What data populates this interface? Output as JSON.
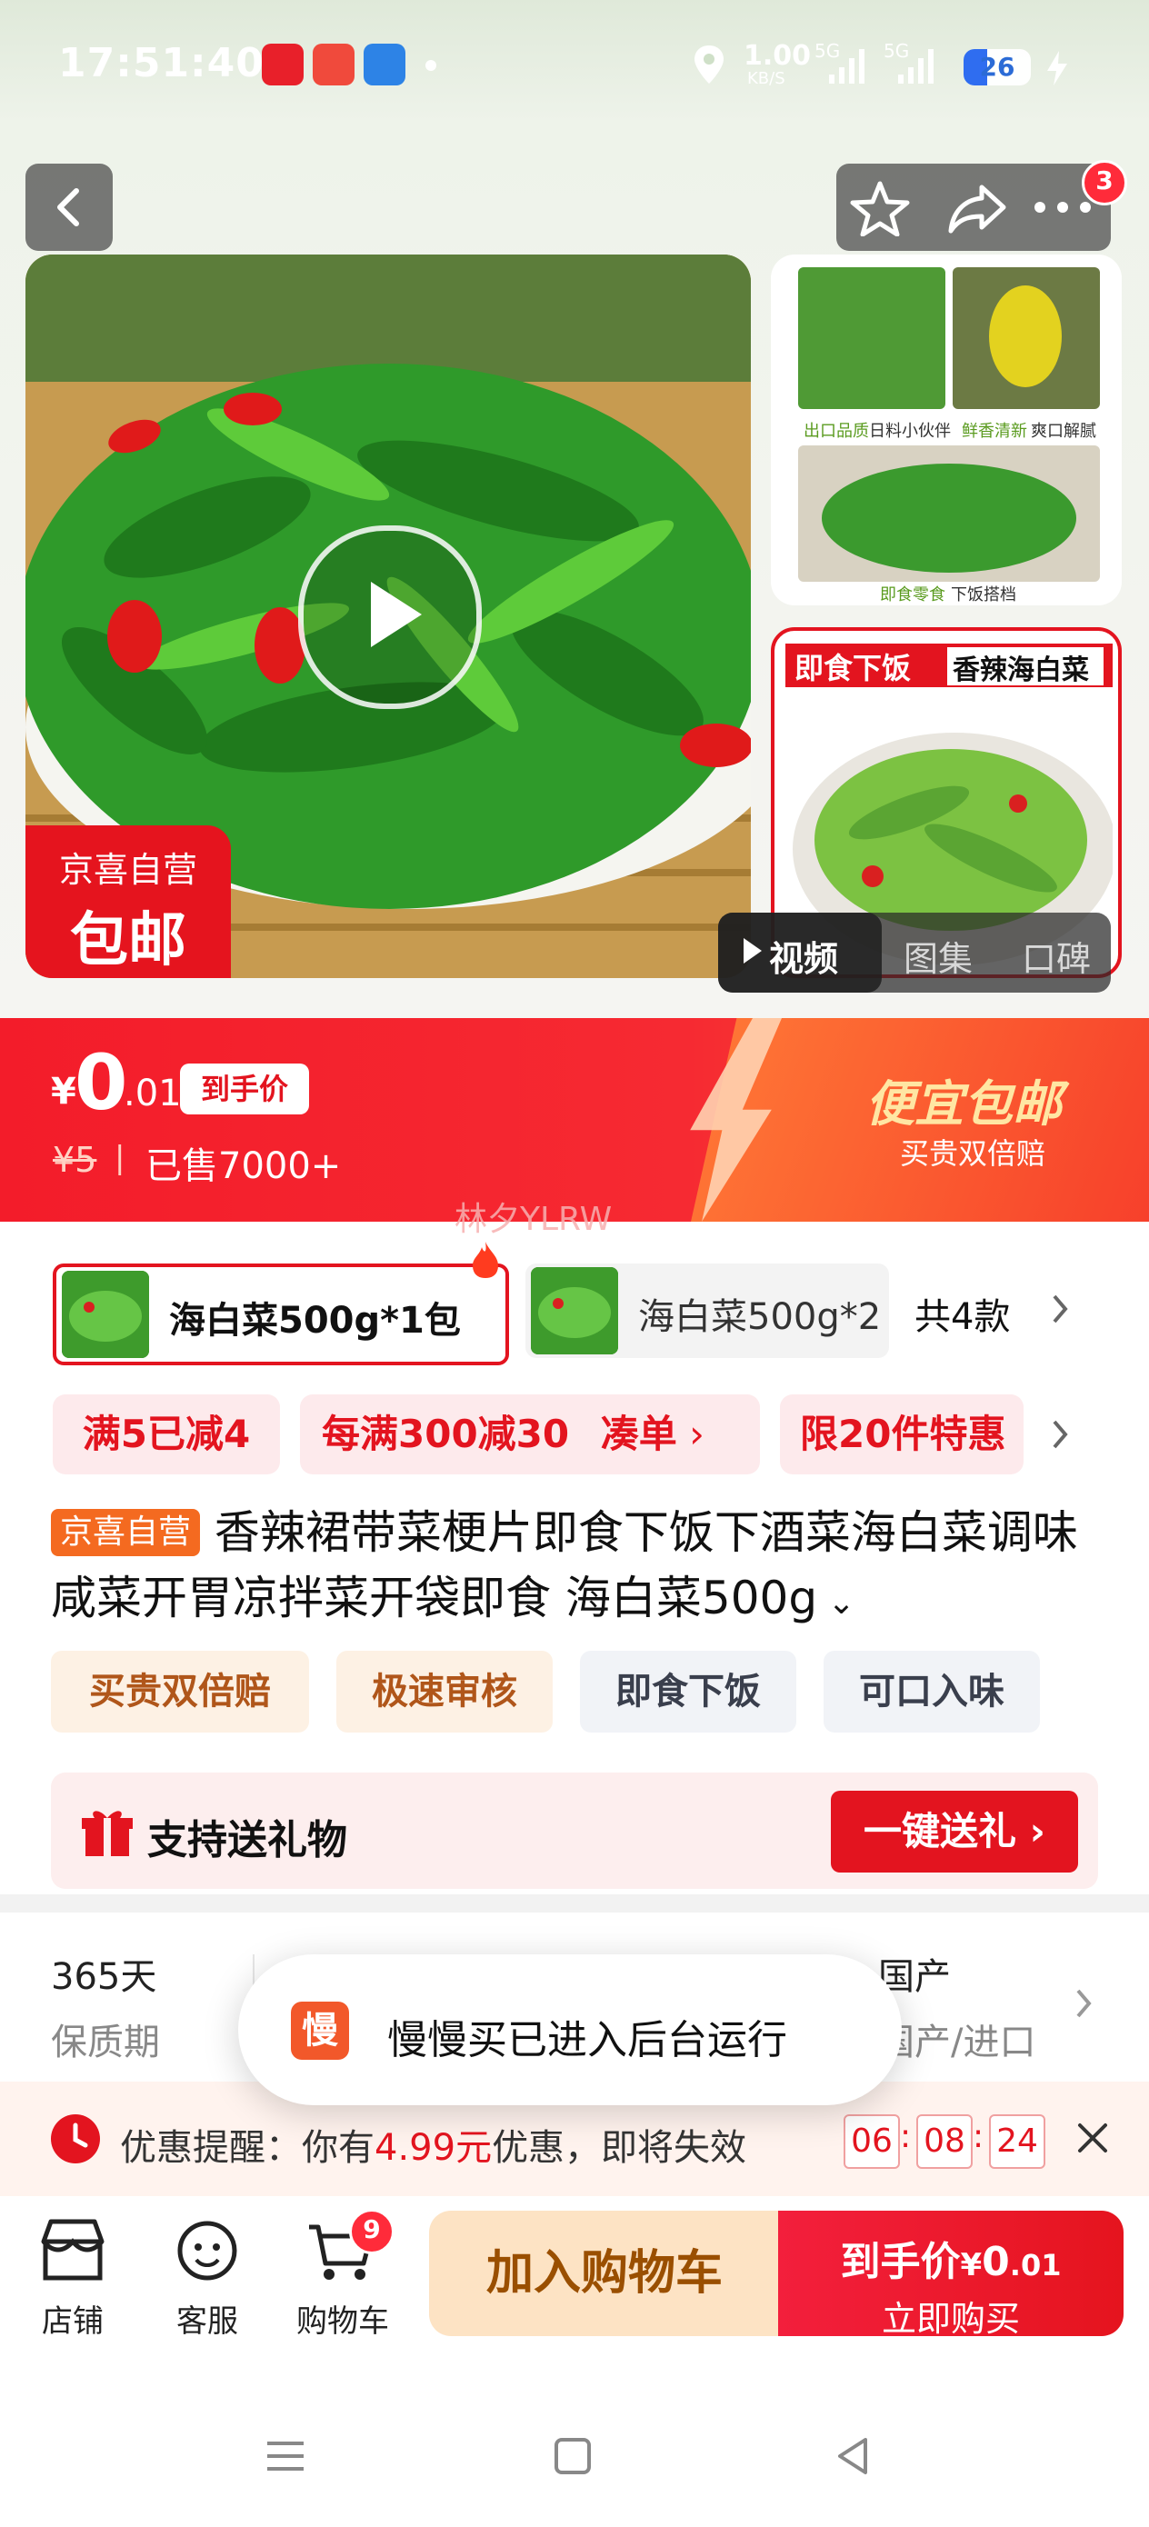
{
  "status_bar": {
    "time": "17:51:40",
    "net_speed": "1.00",
    "net_unit": "KB/S",
    "signal1": "5G",
    "signal2": "5G",
    "battery": "26"
  },
  "header": {
    "notification_count": "3"
  },
  "gallery": {
    "thumb1_captions": [
      "出口品质",
      "日料小伙伴",
      "鲜香清新",
      "爽口解腻",
      "即食零食",
      "下饭搭档"
    ],
    "thumb2_banner_left": "即食下饭",
    "thumb2_banner_right": "香辣海白菜",
    "badge_line1": "京喜自营",
    "badge_line2": "包邮",
    "tabs": [
      "视频",
      "图集",
      "口碑"
    ]
  },
  "price": {
    "currency": "¥",
    "integer": "0",
    "decimal": ".01",
    "tag": "到手价",
    "original": "¥5",
    "separator": "|",
    "sold": "已售7000+",
    "promo_title": "便宜包邮",
    "promo_sub": "买贵双倍赔",
    "watermark": "林夕YLRW"
  },
  "sku": {
    "selected": "海白菜500g*1包",
    "other": "海白菜500g*2",
    "total": "共4款"
  },
  "promos": [
    "满5已减4",
    "每满300减30",
    "凑单",
    "限20件特惠"
  ],
  "product": {
    "store_tag": "京喜自营",
    "title": "香辣裙带菜梗片即食下饭下酒菜海白菜调味咸菜开胃凉拌菜开袋即食 海白菜500g"
  },
  "chips": [
    "买贵双倍赔",
    "极速审核",
    "即食下饭",
    "可口入味"
  ],
  "gift": {
    "label": "支持送礼物",
    "button": "一键送礼"
  },
  "specs": {
    "shelf_value": "365天",
    "shelf_label": "保质期",
    "origin_value": "国产",
    "origin_label": "国产/进口"
  },
  "toast": {
    "icon_char": "慢",
    "text": "慢慢买已进入后台运行"
  },
  "reminder": {
    "prefix": "优惠提醒：你有",
    "amount": "4.99元",
    "suffix": "优惠，即将失效",
    "hh": "06",
    "mm": "08",
    "ss": "24",
    "colon": ":"
  },
  "bottom_bar": {
    "store": "店铺",
    "service": "客服",
    "cart": "购物车",
    "cart_count": "9",
    "add_cart": "加入购物车",
    "buy_line1": "到手价",
    "buy_price_currency": "¥",
    "buy_price_int": "0",
    "buy_price_dec": ".01",
    "buy_line2": "立即购买"
  },
  "colors": {
    "brand_red": "#e3141f",
    "promo_orange": "#f46a20",
    "cart_button": "#fde3c4"
  }
}
